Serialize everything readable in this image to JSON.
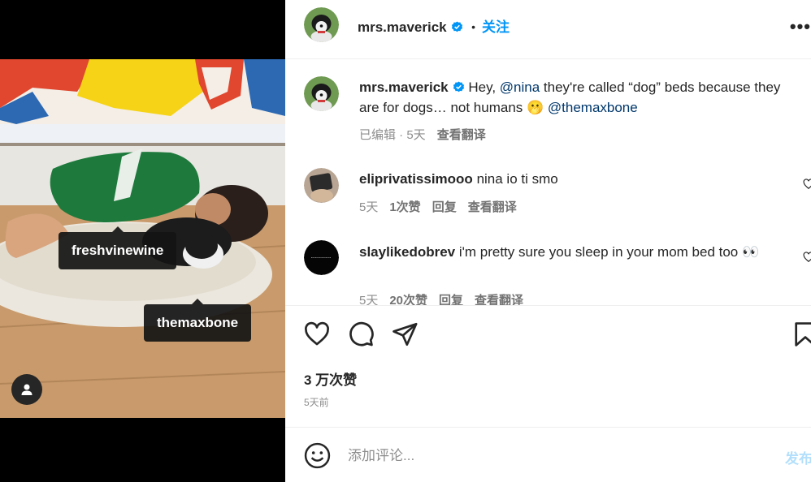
{
  "post": {
    "author": "mrs.maverick",
    "follow_label": "关注",
    "more_label": "•••",
    "dot_separator": "•",
    "photo_tags": [
      "freshvinewine",
      "themaxbone"
    ]
  },
  "caption": {
    "username": "mrs.maverick",
    "text_before": "Hey, ",
    "mention1": "@nina",
    "text_middle": " they're called “dog” beds because they are for dogs… not humans 🫢 ",
    "mention2": "@themaxbone",
    "meta_edited": "已编辑 · 5天",
    "translate_label": "查看翻译"
  },
  "comments": [
    {
      "username": "eliprivatissimooo",
      "text": "nina io ti smo",
      "time": "5天",
      "likes": "1次赞",
      "reply_label": "回复",
      "translate_label": "查看翻译"
    },
    {
      "username": "slaylikedobrev",
      "text": "i'm pretty sure you sleep in your mom bed too 👀",
      "time": "5天",
      "likes": "20次赞",
      "reply_label": "回复",
      "translate_label": "查看翻译"
    }
  ],
  "stats": {
    "likes": "3 万次赞",
    "posted": "5天前"
  },
  "composer": {
    "placeholder": "添加评论...",
    "post_label": "发布"
  },
  "colors": {
    "accent": "#0095f6",
    "mention": "#00376b",
    "muted": "#8e8e8e",
    "post_disabled": "#b2dffc"
  },
  "icons": [
    "verified-badge-icon",
    "heart-icon",
    "comment-icon",
    "share-icon",
    "bookmark-icon",
    "emoji-icon",
    "person-icon"
  ]
}
